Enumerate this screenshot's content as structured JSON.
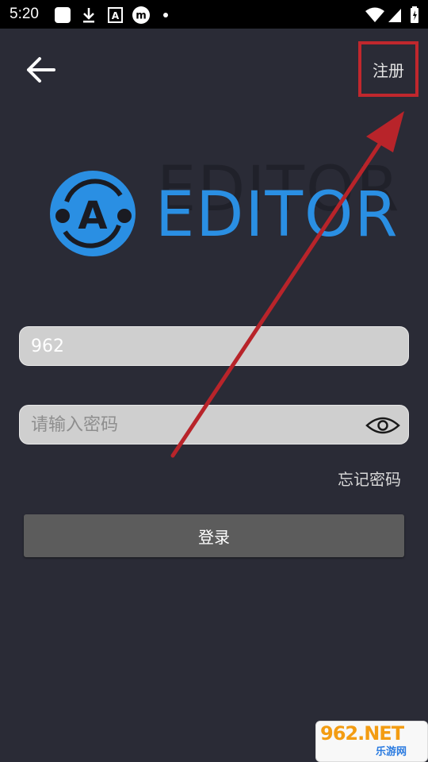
{
  "status_bar": {
    "time": "5:20",
    "icons": [
      "square-icon",
      "download-icon",
      "a-badge-icon",
      "m-circle-icon",
      "dot-icon",
      "wifi-icon",
      "signal-icon",
      "battery-icon"
    ]
  },
  "header": {
    "back_icon": "arrow-left-icon",
    "register_label": "注册"
  },
  "logo": {
    "text": "EDITOR",
    "letter": "A",
    "color": "#2a8fe3"
  },
  "form": {
    "username_value": "962",
    "password_placeholder": "请输入密码",
    "eye_icon": "eye-icon",
    "forgot_label": "忘记密码",
    "login_label": "登录"
  },
  "watermark": {
    "main": "962.NET",
    "sub": "乐游网"
  },
  "colors": {
    "background": "#2a2b36",
    "highlight": "#c0272d",
    "button": "#5c5c5c"
  }
}
